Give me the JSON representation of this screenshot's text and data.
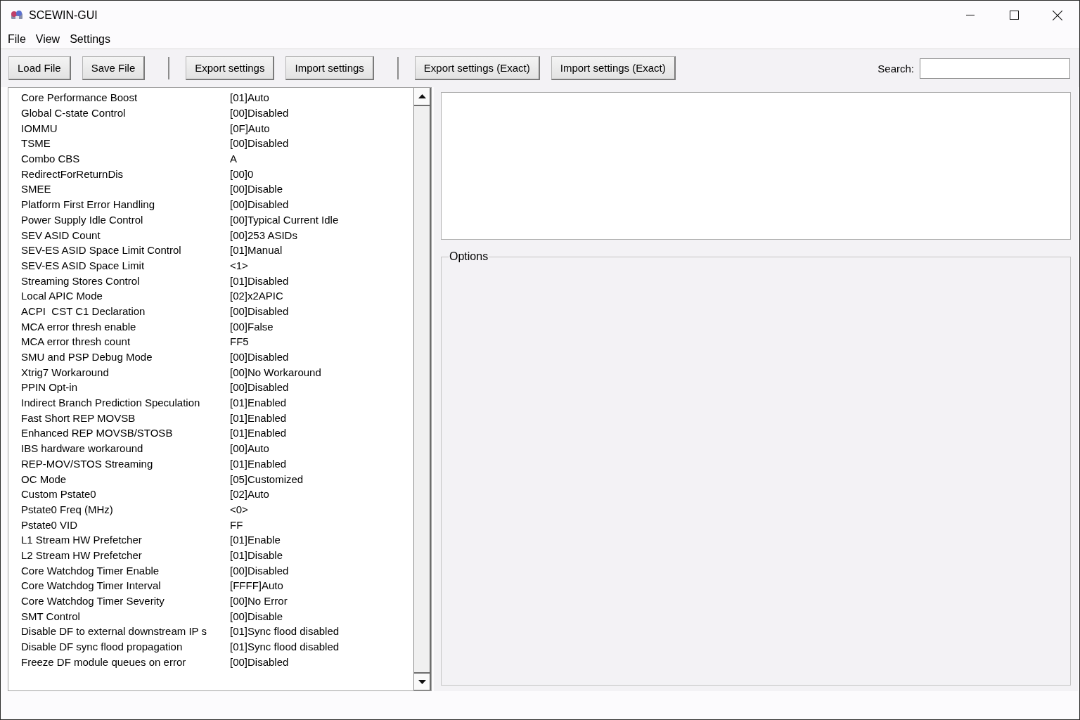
{
  "window": {
    "title": "SCEWIN-GUI"
  },
  "menu_bar": [
    "File",
    "View",
    "Settings"
  ],
  "toolbar": {
    "button_groups": [
      [
        "Load File",
        "Save File"
      ],
      [
        "Export settings",
        "Import settings"
      ],
      [
        "Export settings (Exact)",
        "Import settings (Exact)"
      ]
    ],
    "search": {
      "label": "Search:"
    }
  },
  "settings_list": [
    {
      "name": "Core Performance Boost",
      "value": "[01]Auto"
    },
    {
      "name": "Global C-state Control",
      "value": "[00]Disabled"
    },
    {
      "name": "IOMMU",
      "value": "[0F]Auto"
    },
    {
      "name": "TSME",
      "value": "[00]Disabled"
    },
    {
      "name": "Combo CBS",
      "value": "A"
    },
    {
      "name": "RedirectForReturnDis",
      "value": "[00]0"
    },
    {
      "name": "SMEE",
      "value": "[00]Disable"
    },
    {
      "name": "Platform First Error Handling",
      "value": "[00]Disabled"
    },
    {
      "name": "Power Supply Idle Control",
      "value": "[00]Typical Current Idle"
    },
    {
      "name": "SEV ASID Count",
      "value": "[00]253 ASIDs"
    },
    {
      "name": "SEV-ES ASID Space Limit Control",
      "value": "[01]Manual"
    },
    {
      "name": "SEV-ES ASID Space Limit",
      "value": "<1>"
    },
    {
      "name": "Streaming Stores Control",
      "value": "[01]Disabled"
    },
    {
      "name": "Local APIC Mode",
      "value": "[02]x2APIC"
    },
    {
      "name": "ACPI  CST C1 Declaration",
      "value": "[00]Disabled"
    },
    {
      "name": "MCA error thresh enable",
      "value": "[00]False"
    },
    {
      "name": "MCA error thresh count",
      "value": "FF5"
    },
    {
      "name": "SMU and PSP Debug Mode",
      "value": "[00]Disabled"
    },
    {
      "name": "Xtrig7 Workaround",
      "value": "[00]No Workaround"
    },
    {
      "name": "PPIN Opt-in",
      "value": "[00]Disabled"
    },
    {
      "name": "Indirect Branch Prediction Speculation",
      "value": "[01]Enabled"
    },
    {
      "name": "Fast Short REP MOVSB",
      "value": "[01]Enabled"
    },
    {
      "name": "Enhanced REP MOVSB/STOSB",
      "value": "[01]Enabled"
    },
    {
      "name": "IBS hardware workaround",
      "value": "[00]Auto"
    },
    {
      "name": "REP-MOV/STOS Streaming",
      "value": "[01]Enabled"
    },
    {
      "name": "OC Mode",
      "value": "[05]Customized"
    },
    {
      "name": "Custom Pstate0",
      "value": "[02]Auto"
    },
    {
      "name": "Pstate0 Freq (MHz)",
      "value": "<0>"
    },
    {
      "name": "Pstate0 VID",
      "value": "FF"
    },
    {
      "name": "L1 Stream HW Prefetcher",
      "value": "[01]Enable"
    },
    {
      "name": "L2 Stream HW Prefetcher",
      "value": "[01]Disable"
    },
    {
      "name": "Core Watchdog Timer Enable",
      "value": "[00]Disabled"
    },
    {
      "name": "Core Watchdog Timer Interval",
      "value": "[FFFF]Auto"
    },
    {
      "name": "Core Watchdog Timer Severity",
      "value": "[00]No Error"
    },
    {
      "name": "SMT Control",
      "value": "[00]Disable"
    },
    {
      "name": "Disable DF to external downstream IP s",
      "value": "[01]Sync flood disabled"
    },
    {
      "name": "Disable DF sync flood propagation",
      "value": "[01]Sync flood disabled"
    },
    {
      "name": "Freeze DF module queues on error",
      "value": "[00]Disabled"
    }
  ],
  "options_group": {
    "title": "Options"
  }
}
